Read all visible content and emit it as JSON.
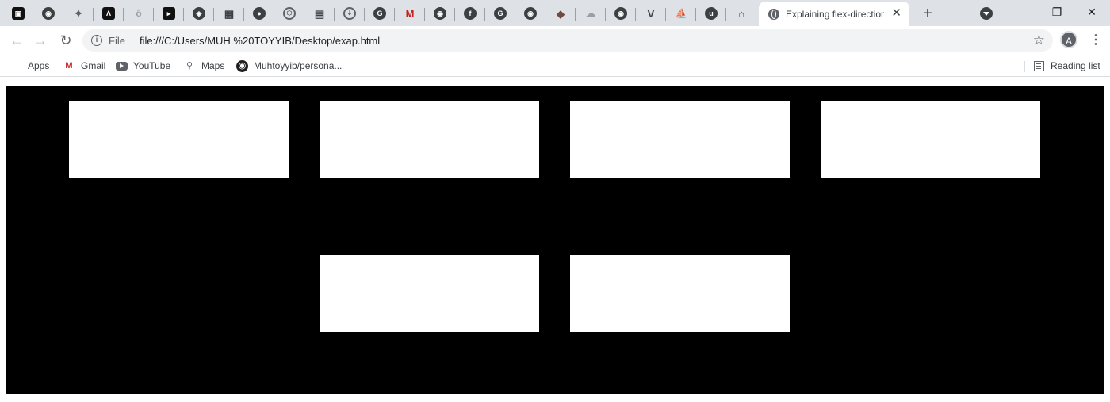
{
  "tabs": {
    "pinned_favicons": [
      "codepen-icon",
      "github-icon",
      "twitter-icon",
      "code-icon",
      "circle-icon",
      "terminal-icon",
      "codesandbox-icon",
      "newsletter-icon",
      "app-icon",
      "hexagon-icon",
      "linkedin-icon",
      "shield-icon",
      "grammarly-icon",
      "gmail-icon",
      "github-icon",
      "facebook-icon",
      "grammarly-icon",
      "github-icon",
      "git-icon",
      "cloud-icon",
      "github-icon",
      "vue-icon",
      "ship-icon",
      "upwork-icon",
      "store-icon"
    ],
    "active": {
      "title": "Explaining flex-direction"
    },
    "new_tab_label": "+",
    "close_symbol": "✕"
  },
  "window_controls": {
    "minimize": "—",
    "restore": "❐",
    "close": "✕"
  },
  "toolbar": {
    "back": "←",
    "forward": "→",
    "reload": "↻",
    "scheme_label": "File",
    "url": "file:///C:/Users/MUH.%20TOYYIB/Desktop/exap.html",
    "bookmark_star": "☆",
    "profile_initial": "A",
    "menu": "⋮"
  },
  "bookmarks": [
    {
      "label": "Apps",
      "icon": "apps-grid-icon"
    },
    {
      "label": "Gmail",
      "icon": "gmail-icon"
    },
    {
      "label": "YouTube",
      "icon": "youtube-icon"
    },
    {
      "label": "Maps",
      "icon": "maps-pin-icon"
    },
    {
      "label": "Muhtoyyib/persona...",
      "icon": "github-icon"
    }
  ],
  "reading_list": {
    "label": "Reading list"
  },
  "page": {
    "background_color": "#000000",
    "box_color": "#ffffff",
    "rows": [
      {
        "box_count": 4
      },
      {
        "box_count": 2
      }
    ]
  }
}
